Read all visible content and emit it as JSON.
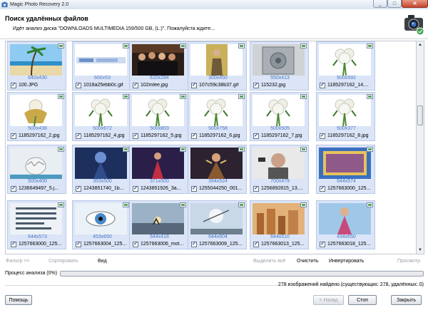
{
  "window": {
    "title": "Magic Photo Recovery 2.0",
    "min_label": "_",
    "max_label": "□",
    "close_label": "✕"
  },
  "header": {
    "title": "Поиск удалённых файлов",
    "subtitle": "Идёт анализ диска \"DOWNLOADS MULTIMEDIA 159/500 GB, (L:)\". Пожалуйста ждите..."
  },
  "scrollbar": {
    "up": "▲",
    "down": "▼"
  },
  "files": [
    {
      "dim": "640x430",
      "name": "100.JPG",
      "checked": true,
      "thumb": "beach"
    },
    {
      "dim": "600x53",
      "name": "1018a25ebb0c.gif",
      "checked": true,
      "thumb": "banner"
    },
    {
      "dim": "610x284",
      "name": "102mlee.jpg",
      "checked": true,
      "thumb": "people"
    },
    {
      "dim": "300x450",
      "name": "107c59c38b37.gif",
      "checked": true,
      "thumb": "figure"
    },
    {
      "dim": "550x413",
      "name": "115232.jpg",
      "checked": true,
      "thumb": "safe"
    },
    {
      "dim": "500x592",
      "name": "1185297162_14....",
      "checked": true,
      "thumb": "bouquet"
    },
    {
      "dim": "500x438",
      "name": "1185297162_2.jpg",
      "checked": true,
      "thumb": "bouquet-gold"
    },
    {
      "dim": "500x672",
      "name": "1185297162_4.jpg",
      "checked": true,
      "thumb": "bouquet"
    },
    {
      "dim": "500x803",
      "name": "1185297162_5.jpg",
      "checked": true,
      "thumb": "bouquet"
    },
    {
      "dim": "500x758",
      "name": "1185297162_6.jpg",
      "checked": true,
      "thumb": "bouquet"
    },
    {
      "dim": "500x505",
      "name": "1185297162_7.jpg",
      "checked": true,
      "thumb": "bouquet"
    },
    {
      "dim": "500x377",
      "name": "1185297162_8.jpg",
      "checked": true,
      "thumb": "bouquet"
    },
    {
      "dim": "500x400",
      "name": "1236649497_5.j...",
      "checked": true,
      "thumb": "egg"
    },
    {
      "dim": "353x500",
      "name": "1243851740_1b...",
      "checked": true,
      "thumb": "fantasy-blue"
    },
    {
      "dim": "371x500",
      "name": "1243851926_3a...",
      "checked": true,
      "thumb": "fantasy-red"
    },
    {
      "dim": "394x524",
      "name": "1255044250_001...",
      "checked": true,
      "thumb": "fairy"
    },
    {
      "dim": "700x479",
      "name": "1256892815_13....",
      "checked": true,
      "thumb": "man"
    },
    {
      "dim": "644x574",
      "name": "1257663000_125...",
      "checked": true,
      "thumb": "card"
    },
    {
      "dim": "644x573",
      "name": "1257663000_125...",
      "checked": true,
      "thumb": "text-card"
    },
    {
      "dim": "453x650",
      "name": "1257663004_125...",
      "checked": true,
      "thumb": "eye"
    },
    {
      "dim": "644x418",
      "name": "1257663006_mot...",
      "checked": true,
      "thumb": "sunset"
    },
    {
      "dim": "644x604",
      "name": "1257663009_125...",
      "checked": true,
      "thumb": "bird"
    },
    {
      "dim": "644x510",
      "name": "1257663013_125...",
      "checked": true,
      "thumb": "city"
    },
    {
      "dim": "434x650",
      "name": "1257663018_125...",
      "checked": true,
      "thumb": "girl"
    }
  ],
  "toolbar": {
    "filter": "Фильтр >>",
    "sort": "Сортировать",
    "view": "Вид",
    "select_all": "Выделить всё",
    "clear": "Очистить",
    "invert": "Инвертировать",
    "preview": "Просмотр"
  },
  "progress": {
    "label": "Процесс анализа (0%)",
    "value_percent": 0
  },
  "status": {
    "text": "278 изображений найдено (существующих: 278, удалённых: 0)"
  },
  "buttons": {
    "help": "Помощь",
    "back": "< Назад",
    "stop": "Стоп",
    "close": "Закрыть"
  },
  "colors": {
    "tile_bg": "#dbe5f7",
    "dim_text": "#4a78c4",
    "progress_fill": "#8cc27a"
  }
}
